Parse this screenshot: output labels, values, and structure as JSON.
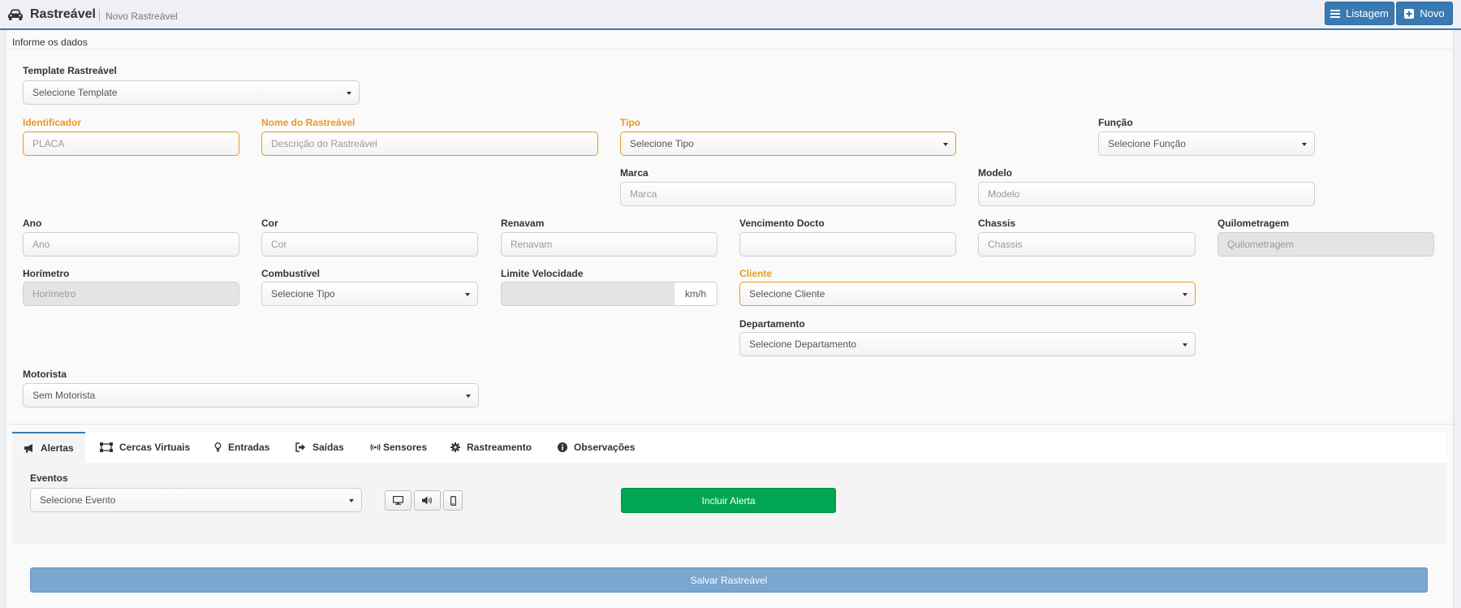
{
  "header": {
    "title": "Rastreável",
    "subtitle": "Novo Rastreável",
    "listagem_label": "Listagem",
    "novo_label": "Novo"
  },
  "panel": {
    "heading": "Informe os dados"
  },
  "form": {
    "template": {
      "label": "Template Rastreável",
      "value": "Selecione Template"
    },
    "identificador": {
      "label": "Identificador",
      "placeholder": "PLACA"
    },
    "nome": {
      "label": "Nome do Rastreável",
      "placeholder": "Descrição do Rastreável"
    },
    "tipo": {
      "label": "Tipo",
      "value": "Selecione Tipo"
    },
    "funcao": {
      "label": "Função",
      "value": "Selecione Função"
    },
    "marca": {
      "label": "Marca",
      "placeholder": "Marca"
    },
    "modelo": {
      "label": "Modelo",
      "placeholder": "Modelo"
    },
    "ano": {
      "label": "Ano",
      "placeholder": "Ano"
    },
    "cor": {
      "label": "Cor",
      "placeholder": "Cor"
    },
    "renavam": {
      "label": "Renavam",
      "placeholder": "Renavam"
    },
    "vencimento": {
      "label": "Vencimento Docto",
      "placeholder": ""
    },
    "chassis": {
      "label": "Chassis",
      "placeholder": "Chassis"
    },
    "quilometragem": {
      "label": "Quilometragem",
      "placeholder": "Quilometragem"
    },
    "horimetro": {
      "label": "Horímetro",
      "placeholder": "Horímetro"
    },
    "combustivel": {
      "label": "Combustível",
      "value": "Selecione Tipo"
    },
    "limite": {
      "label": "Limite Velocidade",
      "unit": "km/h"
    },
    "cliente": {
      "label": "Cliente",
      "value": "Selecione Cliente"
    },
    "departamento": {
      "label": "Departamento",
      "value": "Selecione Departamento"
    },
    "motorista": {
      "label": "Motorista",
      "value": "Sem Motorista"
    }
  },
  "tabs": [
    {
      "label": "Alertas",
      "icon": "bullhorn-icon",
      "active": true
    },
    {
      "label": "Cercas Virtuais",
      "icon": "fence-icon"
    },
    {
      "label": "Entradas",
      "icon": "lightbulb-icon"
    },
    {
      "label": "Saídas",
      "icon": "sign-out-icon"
    },
    {
      "label": "Sensores",
      "icon": "signal-icon"
    },
    {
      "label": "Rastreamento",
      "icon": "gear-icon"
    },
    {
      "label": "Observações",
      "icon": "info-icon"
    }
  ],
  "alertas": {
    "eventos_label": "Eventos",
    "eventos_value": "Selecione Evento",
    "incluir_label": "Incluir Alerta"
  },
  "salvar_label": "Salvar Rastreável",
  "colors": {
    "primary": "#3a7ab3",
    "required": "#e89a24",
    "success": "#00a651",
    "save": "#7aa6cf"
  }
}
